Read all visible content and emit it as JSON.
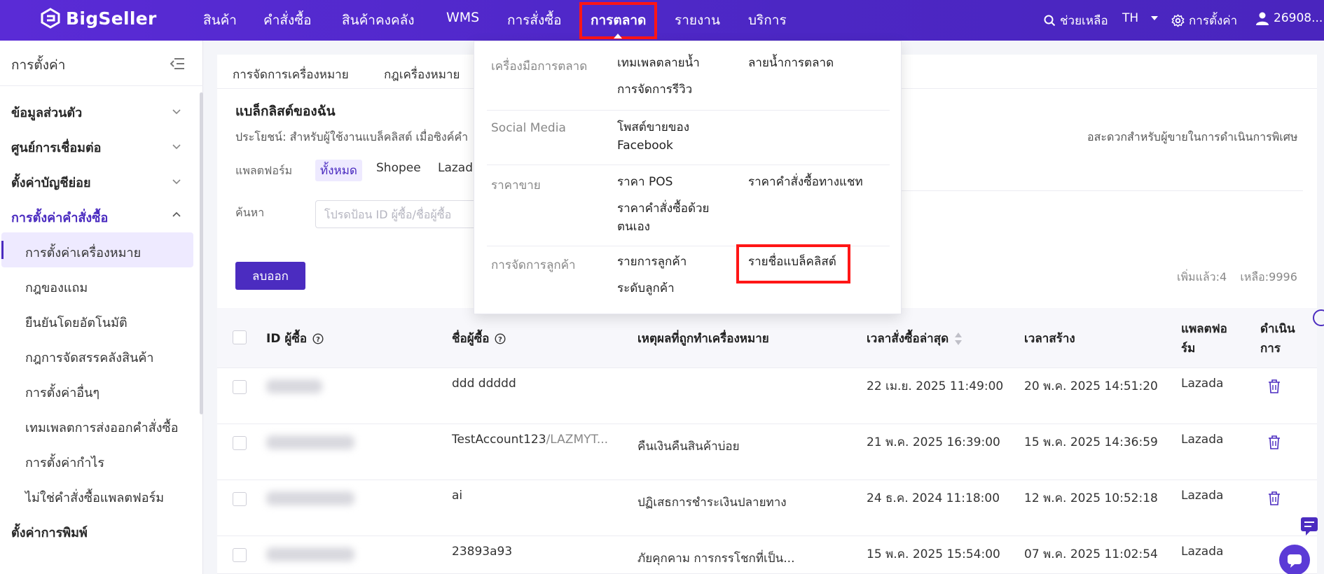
{
  "brand": {
    "name": "BigSeller",
    "accent": "#4b2cc0",
    "highlight": "#ff1616"
  },
  "topnav": {
    "items": [
      {
        "label": "สินค้า"
      },
      {
        "label": "คำสั่งซื้อ"
      },
      {
        "label": "สินค้าคงคลัง"
      },
      {
        "label": "WMS"
      },
      {
        "label": "การสั่งซื้อ"
      },
      {
        "label": "การตลาด"
      },
      {
        "label": "รายงาน"
      },
      {
        "label": "บริการ"
      }
    ],
    "help": "ช่วยเหลือ",
    "language": "TH",
    "settings": "การตั้งค่า",
    "account": "26908..."
  },
  "sidebar": {
    "title": "การตั้งค่า",
    "groups": [
      {
        "label": "ข้อมูลส่วนตัว"
      },
      {
        "label": "ศูนย์การเชื่อมต่อ"
      },
      {
        "label": "ตั้งค่าบัญชีย่อย"
      },
      {
        "label": "การตั้งค่าคำสั่งซื้อ"
      },
      {
        "label": "ตั้งค่าการพิมพ์"
      }
    ],
    "items": [
      {
        "label": "การตั้งค่าเครื่องหมาย"
      },
      {
        "label": "กฎของแถม"
      },
      {
        "label": "ยืนยันโดยอัตโนมัติ"
      },
      {
        "label": "กฎการจัดสรรคลังสินค้า"
      },
      {
        "label": "การตั้งค่าอื่นๆ"
      },
      {
        "label": "เทมเพลตการส่งออกคำสั่งซื้อ"
      },
      {
        "label": "การตั้งค่ากำไร"
      },
      {
        "label": "ไม่ใช่คำสั่งซื้อแพลตฟอร์ม"
      }
    ]
  },
  "main": {
    "tabs": [
      {
        "label": "การจัดการเครื่องหมาย"
      },
      {
        "label": "กฎเครื่องหมาย"
      }
    ],
    "section_title": "แบล็กลิสต์ของฉัน",
    "description": "ประโยชน์: สำหรับผู้ใช้งานแบล็คลิสต์ เมื่อซิงค์คำ",
    "description_tail": "อสะดวกสำหรับผู้ขายในการดำเนินการพิเศษ",
    "platform_label": "แพลตฟอร์ม",
    "platforms": [
      {
        "label": "ทั้งหมด"
      },
      {
        "label": "Shopee"
      },
      {
        "label": "Lazad"
      }
    ],
    "search_label": "ค้นหา",
    "search_placeholder": "โปรดป้อน ID ผู้ซื้อ/ชื่อผู้ซื้อ",
    "delete_button": "ลบออก",
    "added_count": "เพิ่มแล้ว:4",
    "remaining_count": "เหลือ:9996"
  },
  "table": {
    "headers": {
      "buyer_id": "ID ผู้ซื้อ",
      "buyer_name": "ชื่อผู้ซื้อ",
      "reason": "เหตุผลที่ถูกทำเครื่องหมาย",
      "last_order": "เวลาสั่งซื้อล่าสุด",
      "created": "เวลาสร้าง",
      "platform_l1": "แพลตฟอ",
      "platform_l2": "ร์ม",
      "action_l1": "ดำเนิน",
      "action_l2": "การ"
    },
    "rows": [
      {
        "name": "ddd ddddd",
        "name_suffix": "",
        "reason": "",
        "last_order": "22 เม.ย. 2025 11:49:00",
        "created": "20 พ.ค. 2025 14:51:20",
        "platform": "Lazada"
      },
      {
        "name": "TestAccount123",
        "name_suffix": "/LAZMYT...",
        "reason": "คืนเงินคืนสินค้าบ่อย",
        "last_order": "21 พ.ค. 2025 16:39:00",
        "created": "15 พ.ค. 2025 14:36:59",
        "platform": "Lazada"
      },
      {
        "name": "ai",
        "name_suffix": "",
        "reason": "ปฏิเสธการชำระเงินปลายทาง",
        "last_order": "24 ธ.ค. 2024 11:18:00",
        "created": "12 พ.ค. 2025 10:52:18",
        "platform": "Lazada"
      },
      {
        "name": "23893a93",
        "name_suffix": "",
        "reason": "ภัยคุกคาม การกรรโชกที่เป็น...",
        "last_order": "15 พ.ค. 2025 15:54:00",
        "created": "07 พ.ค. 2025 11:02:54",
        "platform": "Lazada"
      }
    ]
  },
  "marketing_menu": {
    "tools": {
      "category": "เครื่องมือการตลาด",
      "links": [
        "เทมเพลตลายน้ำ",
        "การจัดการรีวิว",
        "ลายน้ำการตลาด"
      ]
    },
    "social": {
      "category": "Social Media",
      "links": [
        "โพสต์ขายของ Facebook"
      ]
    },
    "price": {
      "category": "ราคาขาย",
      "links": [
        "ราคา POS",
        "ราคาคำสั่งซื้อด้วยตนเอง",
        "ราคาคำสั่งซื้อทางแชท"
      ]
    },
    "customer": {
      "category": "การจัดการลูกค้า",
      "links": [
        "รายการลูกค้า",
        "ระดับลูกค้า",
        "รายชื่อแบล็คลิสต์"
      ]
    }
  }
}
